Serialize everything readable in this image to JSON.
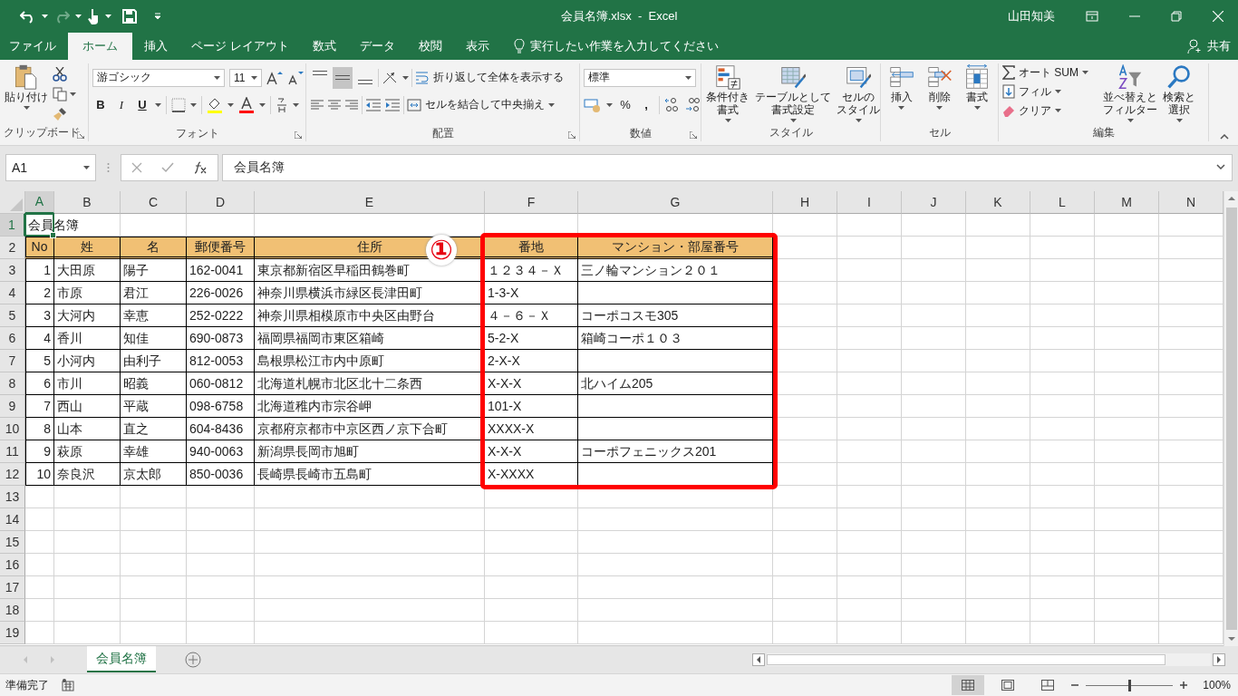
{
  "title_bar": {
    "title": "会員名簿.xlsx  -  Excel",
    "user": "山田知美"
  },
  "tabs": [
    {
      "label": "ファイル",
      "selected": false
    },
    {
      "label": "ホーム",
      "selected": true
    },
    {
      "label": "挿入",
      "selected": false
    },
    {
      "label": "ページ レイアウト",
      "selected": false
    },
    {
      "label": "数式",
      "selected": false
    },
    {
      "label": "データ",
      "selected": false
    },
    {
      "label": "校閲",
      "selected": false
    },
    {
      "label": "表示",
      "selected": false
    }
  ],
  "tell_me": {
    "placeholder": "実行したい作業を入力してください"
  },
  "share": "共有",
  "ribbon": {
    "clipboard": {
      "label": "クリップボード",
      "paste": "貼り付け"
    },
    "font": {
      "label": "フォント",
      "font_name": "游ゴシック",
      "font_size": "11",
      "bold": "B",
      "italic": "I",
      "underline": "U"
    },
    "alignment": {
      "label": "配置",
      "vertical": [
        {
          "kind": "top",
          "selected": false
        },
        {
          "kind": "middle",
          "selected": true
        },
        {
          "kind": "bottom",
          "selected": false
        }
      ],
      "wrap_text": "折り返して全体を表示する",
      "merge_center": "セルを結合して中央揃え"
    },
    "number": {
      "label": "数値",
      "format": "標準",
      "percent": "%",
      "comma": ","
    },
    "styles": {
      "label": "スタイル",
      "buttons": [
        {
          "kind": "conditional",
          "lines": [
            "条件付き",
            "書式"
          ]
        },
        {
          "kind": "table",
          "lines": [
            "テーブルとして",
            "書式設定"
          ]
        },
        {
          "kind": "cell_style",
          "lines": [
            "セルの",
            "スタイル"
          ]
        }
      ]
    },
    "cells": {
      "label": "セル",
      "buttons": [
        {
          "kind": "insert",
          "label": "挿入"
        },
        {
          "kind": "delete",
          "label": "削除"
        },
        {
          "kind": "format",
          "label": "書式"
        }
      ]
    },
    "editing": {
      "label": "編集",
      "autosum": "オート SUM",
      "fill": "フィル",
      "clear": "クリア",
      "sort": [
        "並べ替えと",
        "フィルター"
      ],
      "find": [
        "検索と",
        "選択"
      ]
    }
  },
  "formula_bar": {
    "name_box": "A1",
    "formula": "会員名簿"
  },
  "sheet": {
    "columns": [
      {
        "label": "A",
        "selected": true
      },
      {
        "label": "B",
        "selected": false
      },
      {
        "label": "C",
        "selected": false
      },
      {
        "label": "D",
        "selected": false
      },
      {
        "label": "E",
        "selected": false
      },
      {
        "label": "F",
        "selected": false
      },
      {
        "label": "G",
        "selected": false
      },
      {
        "label": "H",
        "selected": false
      },
      {
        "label": "I",
        "selected": false
      },
      {
        "label": "J",
        "selected": false
      },
      {
        "label": "K",
        "selected": false
      },
      {
        "label": "L",
        "selected": false
      },
      {
        "label": "M",
        "selected": false
      },
      {
        "label": "N",
        "selected": false
      }
    ],
    "rows": [
      {
        "number": "1",
        "selected": true,
        "kind": "title",
        "cells": [
          "会員名簿"
        ]
      },
      {
        "number": "2",
        "selected": false,
        "kind": "header",
        "cells": [
          "No",
          "姓",
          "名",
          "郵便番号",
          "住所",
          "番地",
          "マンション・部屋番号"
        ]
      },
      {
        "number": "3",
        "selected": false,
        "kind": "data",
        "cells": [
          "1",
          "大田原",
          "陽子",
          "162-0041",
          "東京都新宿区早稲田鶴巻町",
          "１２３４－Ｘ",
          "三ノ輪マンション２０１"
        ]
      },
      {
        "number": "4",
        "selected": false,
        "kind": "data",
        "cells": [
          "2",
          "市原",
          "君江",
          "226-0026",
          "神奈川県横浜市緑区長津田町",
          "1-3-X"
        ]
      },
      {
        "number": "5",
        "selected": false,
        "kind": "data",
        "cells": [
          "3",
          "大河内",
          "幸恵",
          "252-0222",
          "神奈川県相模原市中央区由野台",
          "４－６－Ｘ",
          "コーポコスモ305"
        ]
      },
      {
        "number": "6",
        "selected": false,
        "kind": "data",
        "cells": [
          "4",
          "香川",
          "知佳",
          "690-0873",
          "福岡県福岡市東区箱崎",
          "5-2-X",
          "箱崎コーポ１０３"
        ]
      },
      {
        "number": "7",
        "selected": false,
        "kind": "data",
        "cells": [
          "5",
          "小河内",
          "由利子",
          "812-0053",
          "島根県松江市内中原町",
          "2-X-X"
        ]
      },
      {
        "number": "8",
        "selected": false,
        "kind": "data",
        "cells": [
          "6",
          "市川",
          "昭義",
          "060-0812",
          "北海道札幌市北区北十二条西",
          "X-X-X",
          "北ハイム205"
        ]
      },
      {
        "number": "9",
        "selected": false,
        "kind": "data",
        "cells": [
          "7",
          "西山",
          "平蔵",
          "098-6758",
          "北海道稚内市宗谷岬",
          "101-X"
        ]
      },
      {
        "number": "10",
        "selected": false,
        "kind": "data",
        "cells": [
          "8",
          "山本",
          "直之",
          "604-8436",
          "京都府京都市中京区西ノ京下合町",
          "XXXX-X"
        ]
      },
      {
        "number": "11",
        "selected": false,
        "kind": "data",
        "cells": [
          "9",
          "萩原",
          "幸雄",
          "940-0063",
          "新潟県長岡市旭町",
          "X-X-X",
          "コーポフェニックス201"
        ]
      },
      {
        "number": "12",
        "selected": false,
        "kind": "data",
        "cells": [
          "10",
          "奈良沢",
          "京太郎",
          "850-0036",
          "長崎県長崎市五島町",
          "X-XXXX"
        ]
      },
      {
        "number": "13",
        "selected": false,
        "kind": "blank"
      },
      {
        "number": "14",
        "selected": false,
        "kind": "blank"
      },
      {
        "number": "15",
        "selected": false,
        "kind": "blank"
      },
      {
        "number": "16",
        "selected": false,
        "kind": "blank"
      },
      {
        "number": "17",
        "selected": false,
        "kind": "blank"
      },
      {
        "number": "18",
        "selected": false,
        "kind": "blank"
      },
      {
        "number": "19",
        "selected": false,
        "kind": "blank"
      }
    ]
  },
  "annotation": {
    "marker": "①"
  },
  "sheet_tabs": [
    {
      "label": "会員名簿",
      "selected": true
    }
  ],
  "status_bar": {
    "status": "準備完了",
    "views": [
      {
        "kind": "normal",
        "selected": true
      },
      {
        "kind": "page_layout",
        "selected": false
      },
      {
        "kind": "page_break",
        "selected": false
      }
    ],
    "zoom": {
      "level": 0.5,
      "reading": "100%"
    }
  }
}
